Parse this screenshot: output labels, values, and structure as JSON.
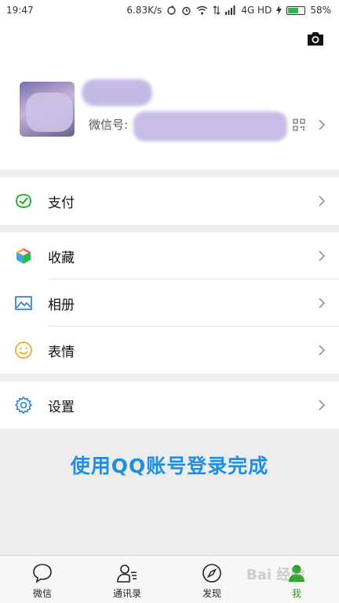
{
  "status_bar": {
    "time": "19:47",
    "net_speed": "6.83K/s",
    "network": "4G HD",
    "battery": "58%",
    "battery_level": 0.58
  },
  "profile": {
    "wechat_id_label": "微信号:",
    "wechat_id_value": "",
    "camera_icon": "camera-icon",
    "qr_icon": "qr-code-icon"
  },
  "menu": {
    "pay": {
      "label": "支付",
      "icon": "wallet-check-icon",
      "color": "#1aad19"
    },
    "favorites": {
      "label": "收藏",
      "icon": "cube-icon"
    },
    "album": {
      "label": "相册",
      "icon": "image-icon",
      "color": "#2782d7"
    },
    "stickers": {
      "label": "表情",
      "icon": "smiley-icon",
      "color": "#f5a623"
    },
    "settings": {
      "label": "设置",
      "icon": "gear-icon",
      "color": "#2782d7"
    }
  },
  "status_message": "使用QQ账号登录完成",
  "tabs": [
    {
      "label": "微信",
      "icon": "chat-bubble-icon",
      "active": false
    },
    {
      "label": "通讯录",
      "icon": "contacts-icon",
      "active": false
    },
    {
      "label": "发现",
      "icon": "compass-icon",
      "active": false
    },
    {
      "label": "我",
      "icon": "person-icon",
      "active": true
    }
  ],
  "accent_color": "#1aad19",
  "watermark": "Bai 经验"
}
